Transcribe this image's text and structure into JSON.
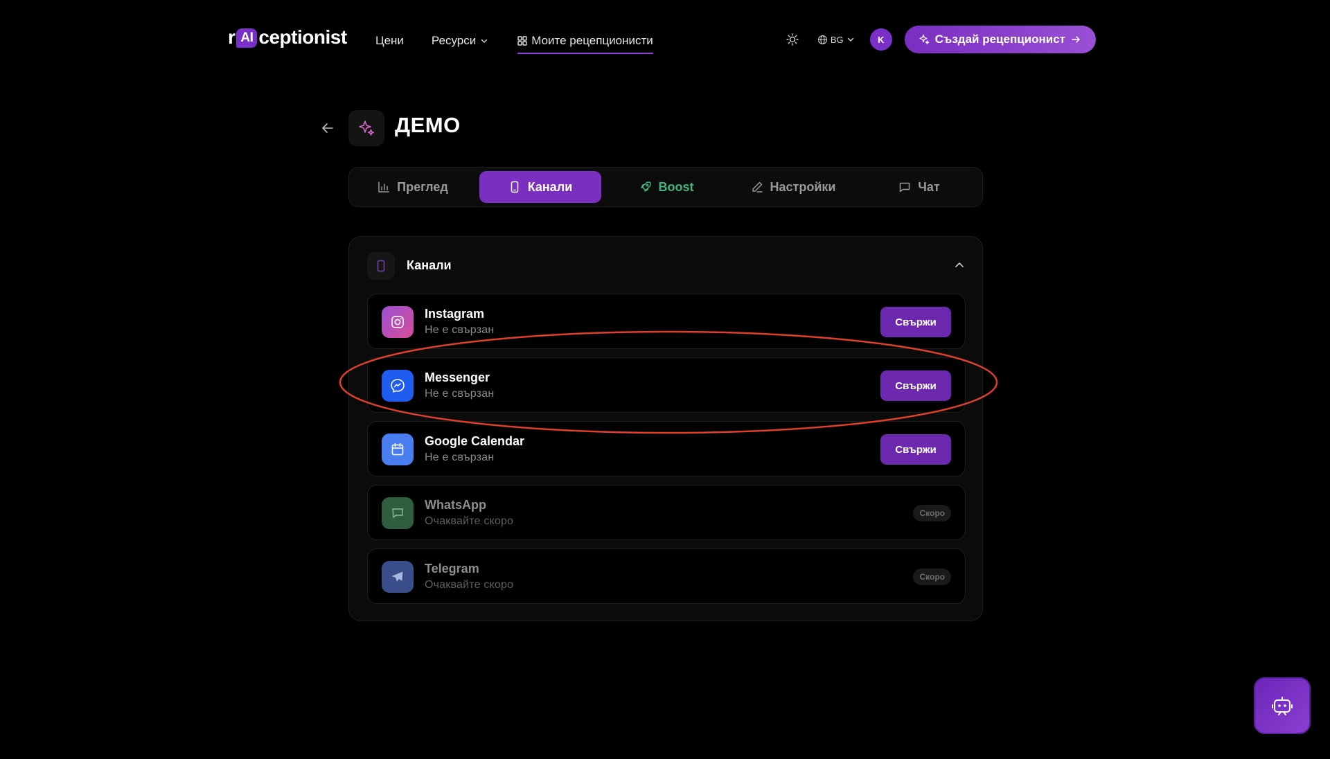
{
  "brand": {
    "prefix": "r",
    "ai": "AI",
    "suffix": "ceptionist"
  },
  "nav": {
    "pricing": "Цени",
    "resources": "Ресурси",
    "my_receptionists": "Моите рецепционисти"
  },
  "header": {
    "language": "BG",
    "avatar_initial": "K",
    "create_button": "Създай рецепционист"
  },
  "page": {
    "title": "ДЕМО"
  },
  "tabs": [
    {
      "label": "Преглед",
      "icon": "bar-chart-icon"
    },
    {
      "label": "Канали",
      "icon": "smartphone-icon",
      "active": true
    },
    {
      "label": "Boost",
      "icon": "rocket-icon"
    },
    {
      "label": "Настройки",
      "icon": "pencil-icon"
    },
    {
      "label": "Чат",
      "icon": "message-square-icon"
    }
  ],
  "channels_panel": {
    "title": "Канали",
    "items": [
      {
        "name": "Instagram",
        "status": "Не е свързан",
        "action": "Свържи",
        "icon": "instagram-icon",
        "color": "#c13584"
      },
      {
        "name": "Messenger",
        "status": "Не е свързан",
        "action": "Свържи",
        "icon": "messenger-icon",
        "color": "#1f5cf0"
      },
      {
        "name": "Google Calendar",
        "status": "Не е свързан",
        "action": "Свържи",
        "icon": "calendar-icon",
        "color": "#4a7df0"
      },
      {
        "name": "WhatsApp",
        "status": "Очаквайте скоро",
        "action": "Скоро",
        "icon": "chat-bubble-icon",
        "color": "#2e5e3e"
      },
      {
        "name": "Telegram",
        "status": "Очаквайте скоро",
        "action": "Скоро",
        "icon": "send-icon",
        "color": "#3a4e8c"
      }
    ]
  },
  "colors": {
    "accent": "#7a2fc0",
    "boost": "#43b581",
    "annotation": "#e0402a"
  }
}
